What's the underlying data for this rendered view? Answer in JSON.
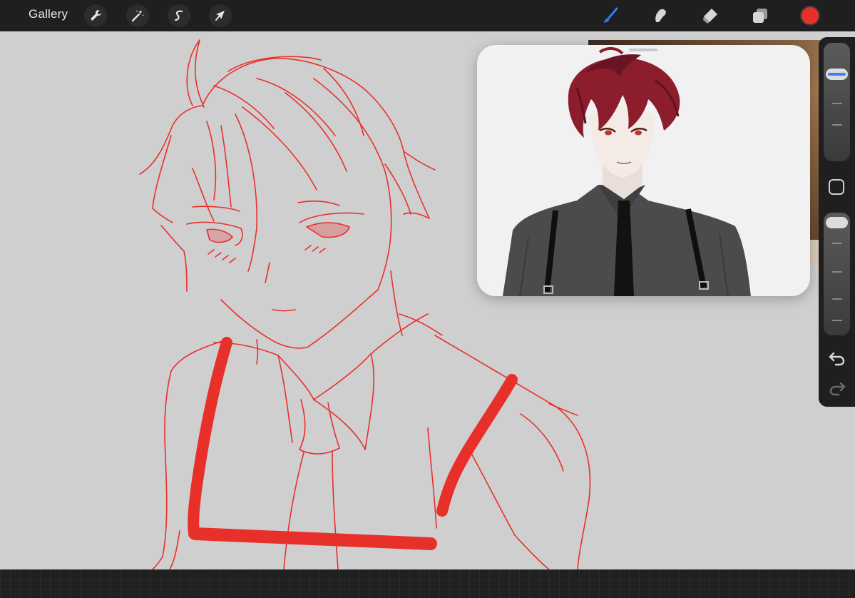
{
  "toolbar": {
    "gallery_label": "Gallery",
    "left_tools": [
      "wrench-icon",
      "magic-wand-icon",
      "s-curve-icon",
      "arrow-cursor-icon"
    ],
    "right_tools": [
      "brush-icon",
      "smudge-icon",
      "eraser-icon",
      "layers-icon"
    ],
    "active_tool": "brush-icon",
    "current_color": "#e8302b"
  },
  "canvas": {
    "background": "#cfcfcf",
    "stroke_color": "#e8302b"
  },
  "reference": {
    "background": "#f1f1f1"
  },
  "sidebar": {
    "size_slider_level": 0.08,
    "opacity_slider_level": 0.0,
    "modify_button": "square-icon",
    "undo": "undo-icon",
    "redo": "redo-icon"
  }
}
